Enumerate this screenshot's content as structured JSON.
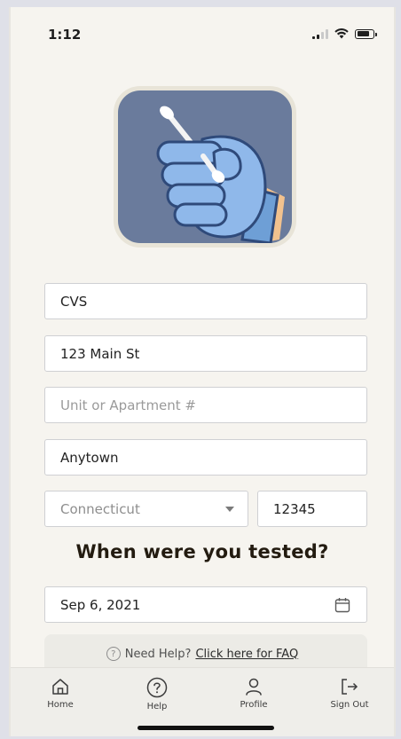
{
  "status_bar": {
    "time": "1:12"
  },
  "form": {
    "name": "CVS",
    "address": "123 Main St",
    "unit_placeholder": "Unit or Apartment #",
    "city": "Anytown",
    "state": "Connecticut",
    "zip": "12345"
  },
  "tested_section": {
    "heading": "When were you tested?",
    "date": "Sep 6, 2021"
  },
  "help": {
    "prefix": "Need Help?",
    "link": "Click here for FAQ"
  },
  "nav": {
    "items": [
      {
        "label": "Home",
        "icon": "home-icon"
      },
      {
        "label": "Help",
        "icon": "help-icon"
      },
      {
        "label": "Profile",
        "icon": "profile-icon"
      },
      {
        "label": "Sign Out",
        "icon": "sign-out-icon"
      }
    ]
  }
}
